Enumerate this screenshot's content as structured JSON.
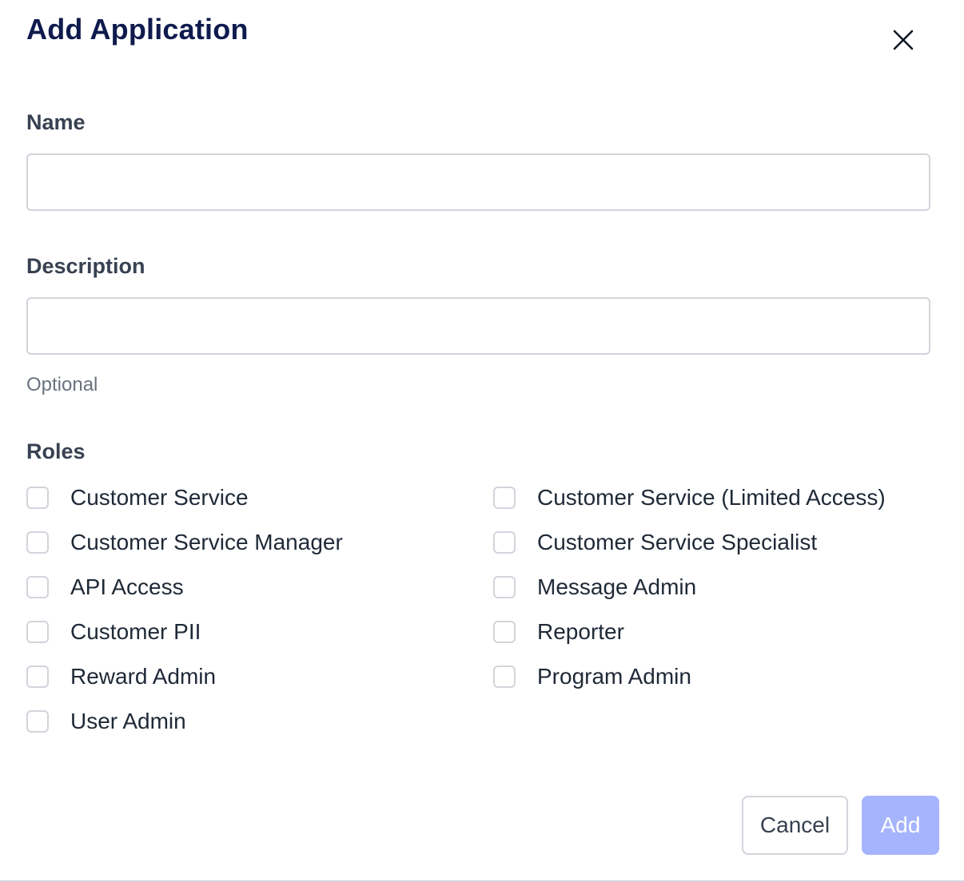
{
  "dialog": {
    "title": "Add Application",
    "close_icon": "close-icon"
  },
  "fields": {
    "name": {
      "label": "Name",
      "value": "",
      "placeholder": ""
    },
    "description": {
      "label": "Description",
      "value": "",
      "placeholder": "",
      "hint": "Optional"
    }
  },
  "roles": {
    "label": "Roles",
    "items": [
      {
        "label": "Customer Service",
        "checked": false
      },
      {
        "label": "Customer Service (Limited Access)",
        "checked": false
      },
      {
        "label": "Customer Service Manager",
        "checked": false
      },
      {
        "label": "Customer Service Specialist",
        "checked": false
      },
      {
        "label": "API Access",
        "checked": false
      },
      {
        "label": "Message Admin",
        "checked": false
      },
      {
        "label": "Customer PII",
        "checked": false
      },
      {
        "label": "Reporter",
        "checked": false
      },
      {
        "label": "Reward Admin",
        "checked": false
      },
      {
        "label": "Program Admin",
        "checked": false
      },
      {
        "label": "User Admin",
        "checked": false
      }
    ]
  },
  "footer": {
    "cancel_label": "Cancel",
    "add_label": "Add"
  },
  "colors": {
    "title": "#0f1b4d",
    "primary_disabled": "#a5b4fc",
    "border": "#d1d5db",
    "hint": "#6b7280"
  }
}
